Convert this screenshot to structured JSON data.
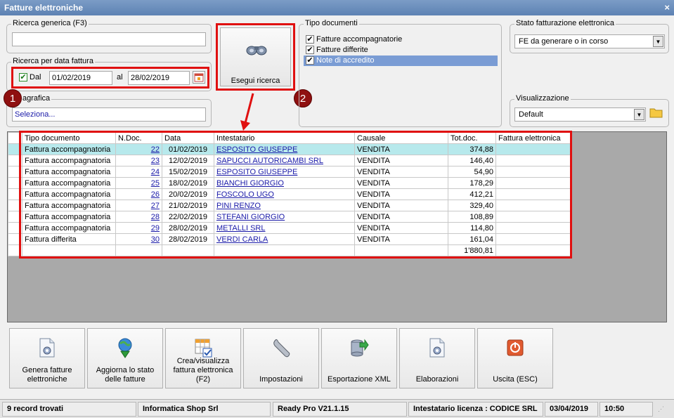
{
  "window": {
    "title": "Fatture elettroniche",
    "close_label": "×"
  },
  "ricerca_generica": {
    "label": "Ricerca generica (F3)",
    "value": ""
  },
  "ricerca_data": {
    "label": "Ricerca per data fattura",
    "dal_label": "Dal",
    "dal_checked": true,
    "dal_value": "01/02/2019",
    "al_label": "al",
    "al_value": "28/02/2019"
  },
  "anagrafica": {
    "label": "agrafica",
    "placeholder": "Seleziona..."
  },
  "esegui_ricerca": {
    "label": "Esegui ricerca"
  },
  "tipo_documenti": {
    "label": "Tipo documenti",
    "items": [
      {
        "label": "Fatture accompagnatorie",
        "checked": true,
        "selected": false
      },
      {
        "label": "Fatture differite",
        "checked": true,
        "selected": false
      },
      {
        "label": "Note di accredito",
        "checked": true,
        "selected": true
      }
    ]
  },
  "stato_fe": {
    "label": "Stato fatturazione elettronica",
    "value": "FE da generare o in corso"
  },
  "visualizzazione": {
    "label": "Visualizzazione",
    "value": "Default"
  },
  "badges": {
    "one": "1",
    "two": "2"
  },
  "grid": {
    "headers": {
      "tipo": "Tipo documento",
      "ndoc": "N.Doc.",
      "data": "Data",
      "intestatario": "Intestatario",
      "causale": "Causale",
      "tot": "Tot.doc.",
      "fe": "Fattura elettronica"
    },
    "rows": [
      {
        "tipo": "Fattura accompagnatoria",
        "ndoc": "22",
        "data": "01/02/2019",
        "intestatario": "ESPOSITO GIUSEPPE",
        "causale": "VENDITA",
        "tot": "374,88"
      },
      {
        "tipo": "Fattura accompagnatoria",
        "ndoc": "23",
        "data": "12/02/2019",
        "intestatario": "SAPUCCI AUTORICAMBI SRL",
        "causale": "VENDITA",
        "tot": "146,40"
      },
      {
        "tipo": "Fattura accompagnatoria",
        "ndoc": "24",
        "data": "15/02/2019",
        "intestatario": "ESPOSITO GIUSEPPE",
        "causale": "VENDITA",
        "tot": "54,90"
      },
      {
        "tipo": "Fattura accompagnatoria",
        "ndoc": "25",
        "data": "18/02/2019",
        "intestatario": "BIANCHI GIORGIO",
        "causale": "VENDITA",
        "tot": "178,29"
      },
      {
        "tipo": "Fattura accompagnatoria",
        "ndoc": "26",
        "data": "20/02/2019",
        "intestatario": "FOSCOLO UGO",
        "causale": "VENDITA",
        "tot": "412,21"
      },
      {
        "tipo": "Fattura accompagnatoria",
        "ndoc": "27",
        "data": "21/02/2019",
        "intestatario": "PINI RENZO",
        "causale": "VENDITA",
        "tot": "329,40"
      },
      {
        "tipo": "Fattura accompagnatoria",
        "ndoc": "28",
        "data": "22/02/2019",
        "intestatario": "STEFANI GIORGIO",
        "causale": "VENDITA",
        "tot": "108,89"
      },
      {
        "tipo": "Fattura accompagnatoria",
        "ndoc": "29",
        "data": "28/02/2019",
        "intestatario": "METALLI SRL",
        "causale": "VENDITA",
        "tot": "114,80"
      },
      {
        "tipo": "Fattura differita",
        "ndoc": "30",
        "data": "28/02/2019",
        "intestatario": "VERDI CARLA",
        "causale": "VENDITA",
        "tot": "161,04"
      }
    ],
    "total": "1'880,81"
  },
  "buttons": [
    {
      "label": "Genera fatture elettroniche",
      "icon": "document-gear-icon"
    },
    {
      "label": "Aggiorna lo stato delle fatture",
      "icon": "globe-download-icon"
    },
    {
      "label": "Crea/visualizza fattura elettronica (F2)",
      "icon": "grid-check-icon"
    },
    {
      "label": "Impostazioni",
      "icon": "wrench-icon"
    },
    {
      "label": "Esportazione XML",
      "icon": "database-export-icon"
    },
    {
      "label": "Elaborazioni",
      "icon": "document-gear-icon"
    },
    {
      "label": "Uscita (ESC)",
      "icon": "power-icon"
    }
  ],
  "status": {
    "records": "9 record trovati",
    "company": "Informatica Shop Srl",
    "version": "Ready Pro V21.1.15",
    "license": "Intestatario licenza : CODICE SRL",
    "date": "03/04/2019",
    "time": "10:50"
  },
  "colors": {
    "title_bar": "#5d82b3",
    "highlight_red": "#e01010",
    "badge": "#8f1010",
    "row_highlight": "#b7e9ec"
  }
}
